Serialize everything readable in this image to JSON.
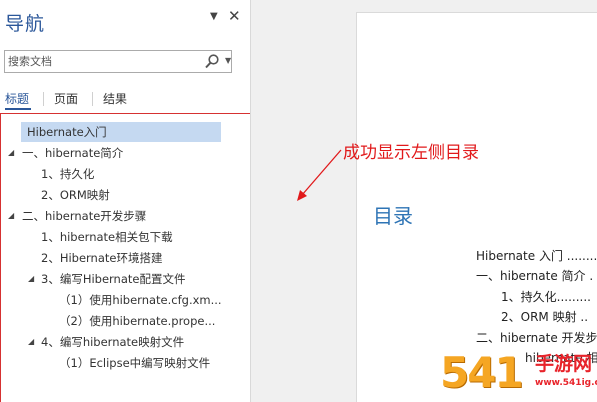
{
  "nav": {
    "title": "导航",
    "search": {
      "placeholder": "搜索文档"
    },
    "tabs": [
      {
        "label": "标题",
        "active": true
      },
      {
        "label": "页面",
        "active": false
      },
      {
        "label": "结果",
        "active": false
      }
    ],
    "outline": [
      {
        "label": "Hibernate入门",
        "level": 0,
        "selected": true,
        "expanded": null
      },
      {
        "label": "一、hibernate简介",
        "level": 0,
        "selected": false,
        "expanded": true
      },
      {
        "label": "1、持久化",
        "level": 1,
        "selected": false,
        "expanded": null
      },
      {
        "label": "2、ORM映射",
        "level": 1,
        "selected": false,
        "expanded": null
      },
      {
        "label": "二、hibernate开发步骤",
        "level": 0,
        "selected": false,
        "expanded": true
      },
      {
        "label": "1、hibernate相关包下载",
        "level": 1,
        "selected": false,
        "expanded": null
      },
      {
        "label": "2、Hibernate环境搭建",
        "level": 1,
        "selected": false,
        "expanded": null
      },
      {
        "label": "3、编写Hibernate配置文件",
        "level": 1,
        "selected": false,
        "expanded": true
      },
      {
        "label": "（1）使用hibernate.cfg.xm...",
        "level": 2,
        "selected": false,
        "expanded": null
      },
      {
        "label": "（2）使用hibernate.prope...",
        "level": 2,
        "selected": false,
        "expanded": null
      },
      {
        "label": "4、编写hibernate映射文件",
        "level": 1,
        "selected": false,
        "expanded": true
      },
      {
        "label": "（1）Eclipse中编写映射文件",
        "level": 2,
        "selected": false,
        "expanded": null
      }
    ]
  },
  "document": {
    "toc_title": "目录",
    "toc_lines": [
      "Hibernate 入门 ........",
      "一、hibernate 简介 .",
      "1、持久化.........",
      "2、ORM 映射 ..",
      "二、hibernate 开发步",
      "hibernate 相"
    ]
  },
  "annotation": {
    "text": "成功显示左侧目录"
  },
  "watermark": {
    "digits": "541",
    "text": "手游网",
    "url": "www.541ig.com"
  },
  "colors": {
    "accent": "#2b579a",
    "annotation": "#e1191b",
    "selection": "#c5d9f1"
  }
}
